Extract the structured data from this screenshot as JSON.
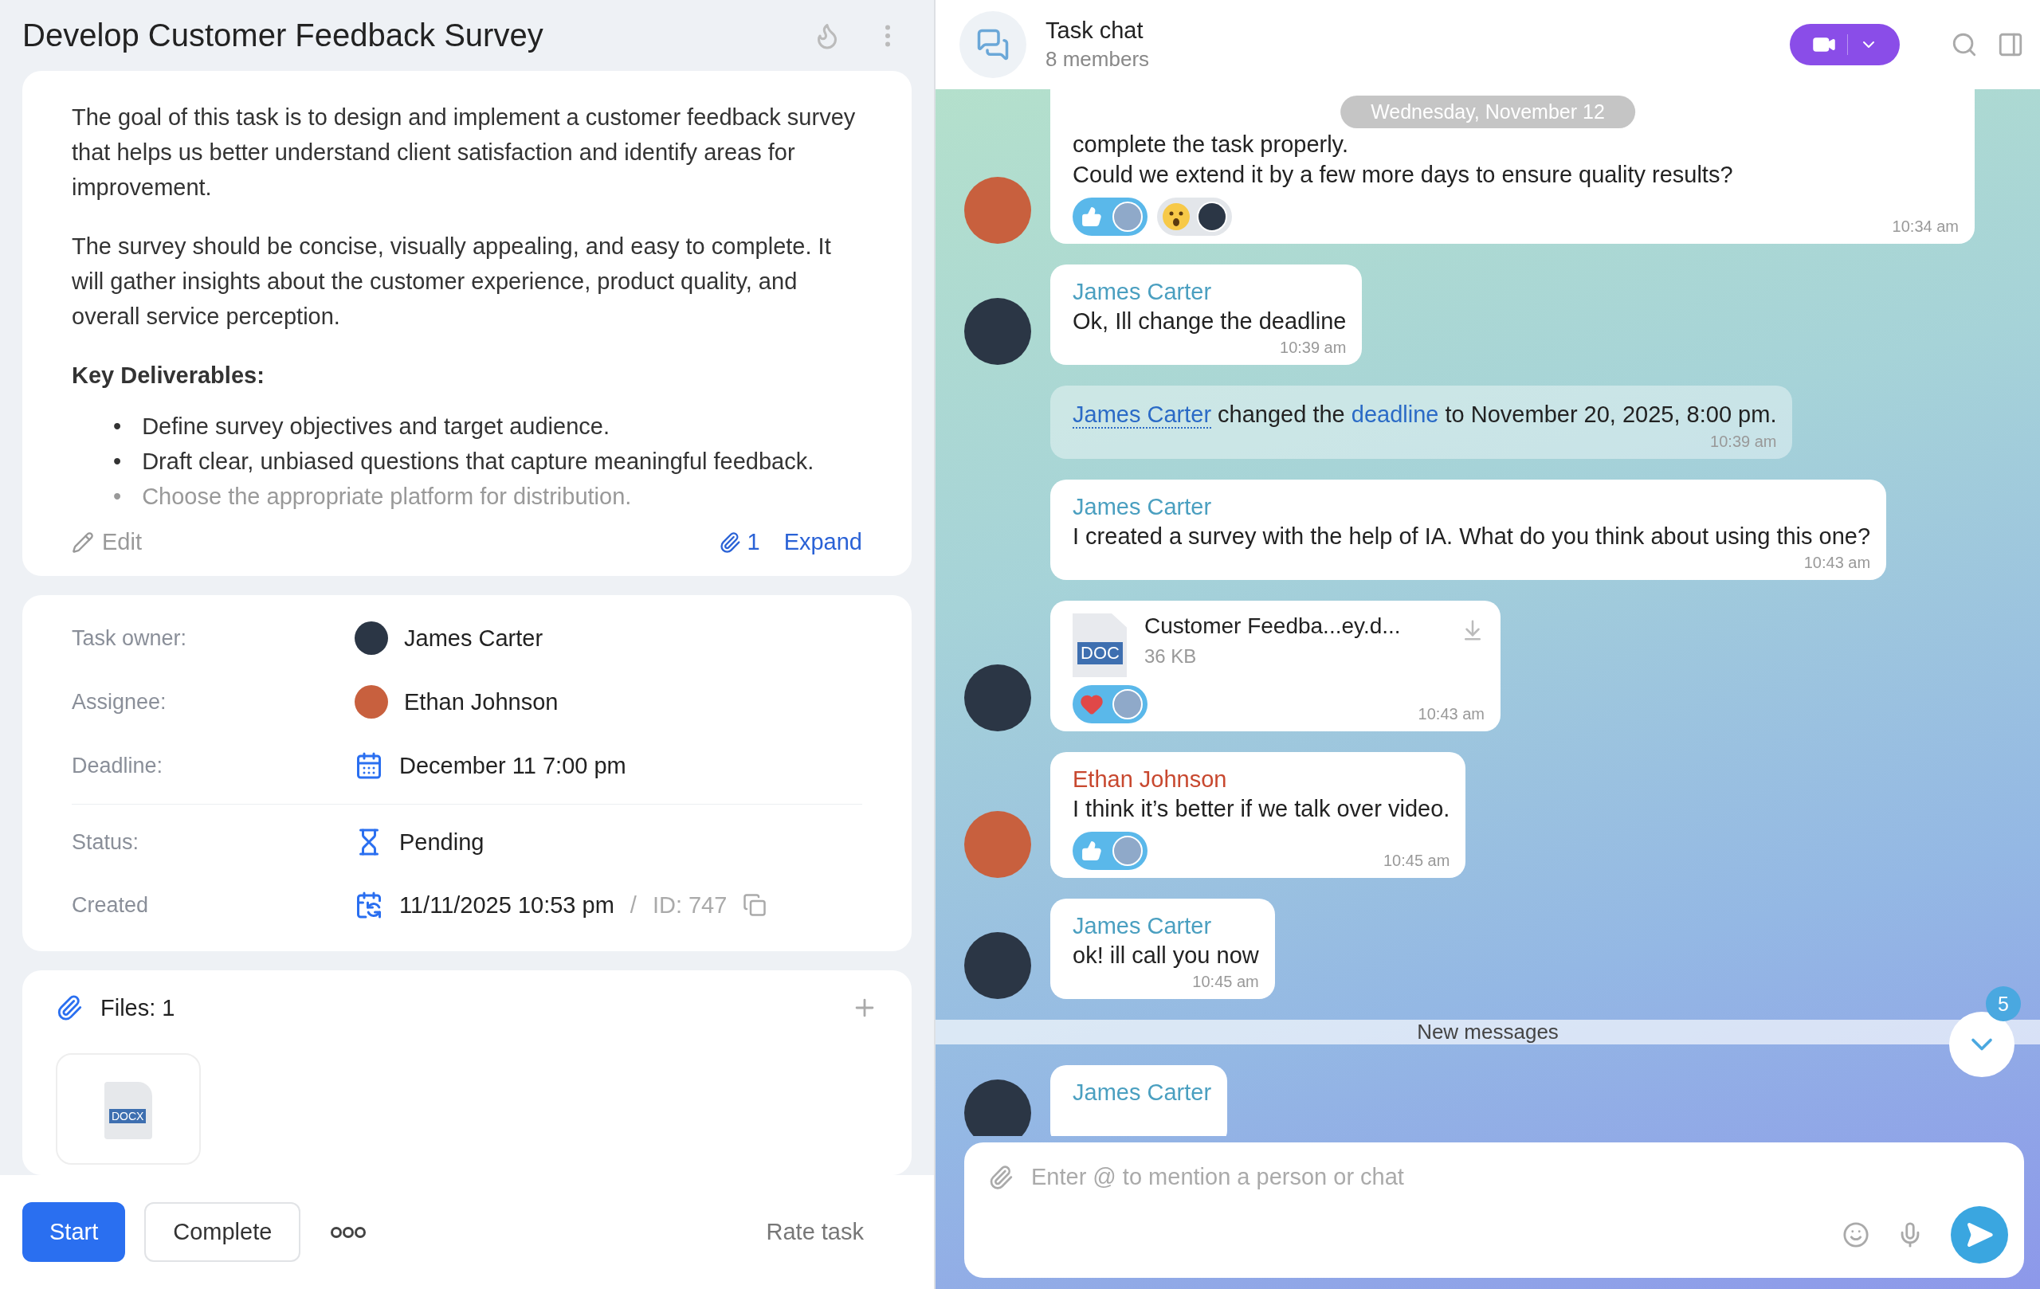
{
  "task": {
    "title": "Develop Customer Feedback Survey",
    "description": {
      "paragraphs": [
        "The goal of this task is to design and implement a customer feedback survey that helps us better understand client satisfaction and identify areas for improvement.",
        "The survey should be concise, visually appealing, and easy to complete. It will gather insights about the customer experience, product quality, and overall service perception."
      ],
      "heading": "Key Deliverables:",
      "marker": "•",
      "bullets": [
        "Define survey objectives and target audience.",
        "Draft clear, unbiased questions that capture meaningful feedback.",
        "Choose the appropriate platform for distribution."
      ]
    },
    "edit_label": "Edit",
    "attachment_count": "1",
    "expand_label": "Expand"
  },
  "details": [
    {
      "kind": "person",
      "label": "Task owner:",
      "value": "James Carter",
      "color": "#2b3645"
    },
    {
      "kind": "person",
      "label": "Assignee:",
      "value": "Ethan Johnson",
      "color": "#c8603e"
    },
    {
      "kind": "date",
      "label": "Deadline:",
      "value": "December 11 7:00 pm"
    },
    {
      "kind": "status",
      "label": "Status:",
      "value": "Pending"
    },
    {
      "kind": "created",
      "label": "Created",
      "value": "11/11/2025 10:53 pm",
      "separator": "/",
      "id": "ID: 747"
    }
  ],
  "files": {
    "title": "Files: 1",
    "items": [
      {
        "type": "DOCX"
      }
    ]
  },
  "footer": {
    "buttons": [
      {
        "label": "Start",
        "kind": "primary"
      },
      {
        "label": "Complete",
        "kind": "secondary"
      }
    ],
    "rate_label": "Rate task"
  },
  "chat": {
    "title": "Task chat",
    "members": "8 members",
    "date_label": "Wednesday, November 12",
    "messages": [
      {
        "kind": "text",
        "avatar": {
          "color": "#c8603e"
        },
        "text": "complete the task properly.\nCould we extend it by a few more days to ensure quality results?",
        "reactions": [
          {
            "kind": "like",
            "selected": true,
            "color": "#8fa9c9"
          },
          {
            "kind": "wow",
            "selected": false,
            "color": "#2b3645"
          }
        ],
        "time": "10:34 am"
      },
      {
        "kind": "text",
        "avatar": {
          "color": "#2b3645"
        },
        "sender": {
          "name": "James Carter",
          "color": "#4a9fc0"
        },
        "text": "Ok, Ill change the deadline",
        "time": "10:39 am"
      },
      {
        "kind": "event",
        "actor": "James Carter",
        "verb": "changed the",
        "field": "deadline",
        "rest": "to November 20, 2025, 8:00 pm.",
        "time": "10:39 am"
      },
      {
        "kind": "text",
        "sender": {
          "name": "James Carter",
          "color": "#4a9fc0"
        },
        "text": "I created a survey with the help of IA. What do you think about using this one?",
        "time": "10:43 am"
      },
      {
        "kind": "file",
        "avatar": {
          "color": "#2b3645"
        },
        "file": {
          "type": "DOC",
          "name": "Customer Feedba...ey.d...",
          "size": "36 KB"
        },
        "reactions": [
          {
            "kind": "heart",
            "selected": true,
            "color": "#8fa9c9"
          }
        ],
        "time": "10:43 am"
      },
      {
        "kind": "text",
        "avatar": {
          "color": "#c8603e"
        },
        "sender": {
          "name": "Ethan Johnson",
          "color": "#c8482f"
        },
        "text": "I think it’s better if we talk over video.",
        "reactions": [
          {
            "kind": "like",
            "selected": true,
            "color": "#8fa9c9"
          }
        ],
        "time": "10:45 am"
      },
      {
        "kind": "text",
        "avatar": {
          "color": "#2b3645"
        },
        "sender": {
          "name": "James Carter",
          "color": "#4a9fc0"
        },
        "text": "ok! ill call you now",
        "time": "10:45 am"
      },
      {
        "kind": "divider",
        "label": "New messages"
      },
      {
        "kind": "text",
        "avatar": {
          "color": "#2b3645"
        },
        "sender": {
          "name": "James Carter",
          "color": "#4a9fc0"
        }
      }
    ],
    "unread_count": "5",
    "composer": {
      "placeholder": "Enter @ to mention a person or chat"
    }
  }
}
